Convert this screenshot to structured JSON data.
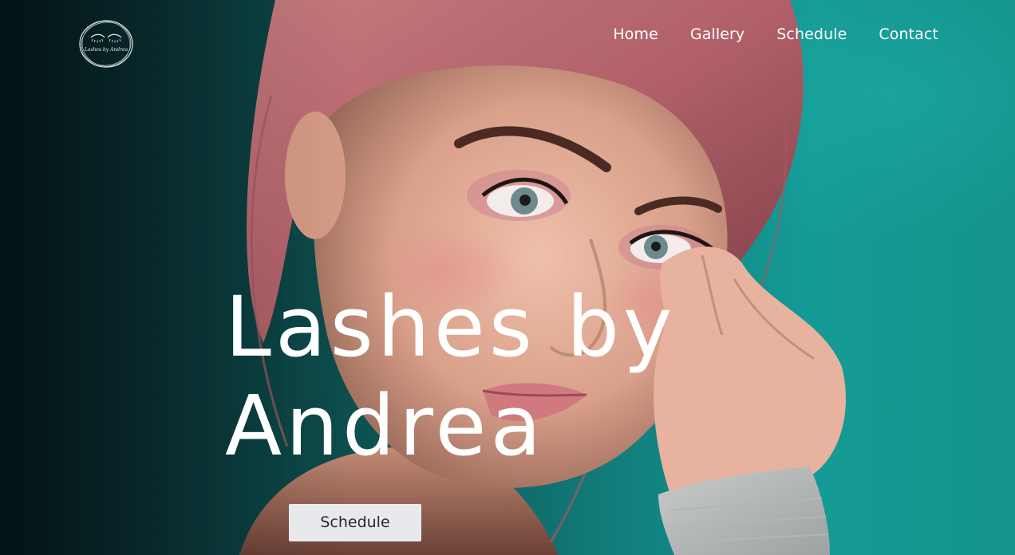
{
  "brand": {
    "logo_icon": "lashes-logo-icon",
    "logo_text": "Lashes by Andrea"
  },
  "nav": {
    "items": [
      {
        "label": "Home"
      },
      {
        "label": "Gallery"
      },
      {
        "label": "Schedule"
      },
      {
        "label": "Contact"
      }
    ]
  },
  "hero": {
    "title_line1": "Lashes by",
    "title_line2": "Andrea",
    "cta_label": "Schedule",
    "photo": "portrait-of-woman-with-pink-hair-photo"
  },
  "colors": {
    "background_teal": "#159b96",
    "background_dark": "#04181c",
    "text": "#ffffff",
    "button_bg": "#e8e9ec",
    "button_text": "#2b2b2b",
    "hair": "#b5656f",
    "skin": "#e3ad97"
  }
}
